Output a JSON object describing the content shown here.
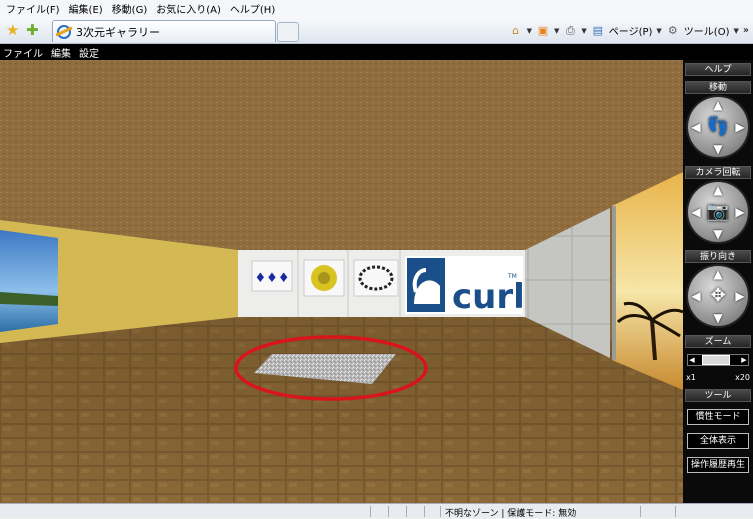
{
  "browser": {
    "menu": [
      "ファイル(F)",
      "編集(E)",
      "移動(G)",
      "お気に入り(A)",
      "ヘルプ(H)"
    ],
    "tab_title": "3次元ギャラリー",
    "page_label": "ページ(P)",
    "tools_label": "ツール(O)",
    "overflow": "»"
  },
  "app": {
    "menu": [
      "ファイル",
      "編集",
      "設定"
    ]
  },
  "panel": {
    "help": "ヘルプ",
    "move": "移動",
    "camera": "カメラ回転",
    "orientation": "振り向き",
    "zoom": "ズーム",
    "zoom_min": "x1",
    "zoom_max": "x20",
    "zoom_level": 0.4,
    "tools": "ツール",
    "buttons": [
      "慣性モード",
      "全体表示",
      "操作履歴再生"
    ]
  },
  "scene": {
    "logo_text": "curl",
    "logo_tm": "TM"
  },
  "status": {
    "text": "不明なゾーン | 保護モード: 無効"
  },
  "colors": {
    "highlight_ring": "#d9141b",
    "floor": "#7a5a30",
    "ceiling": "#8f6d3e",
    "left_wall": "#e2c45a",
    "curl_blue": "#1b4f8a"
  }
}
